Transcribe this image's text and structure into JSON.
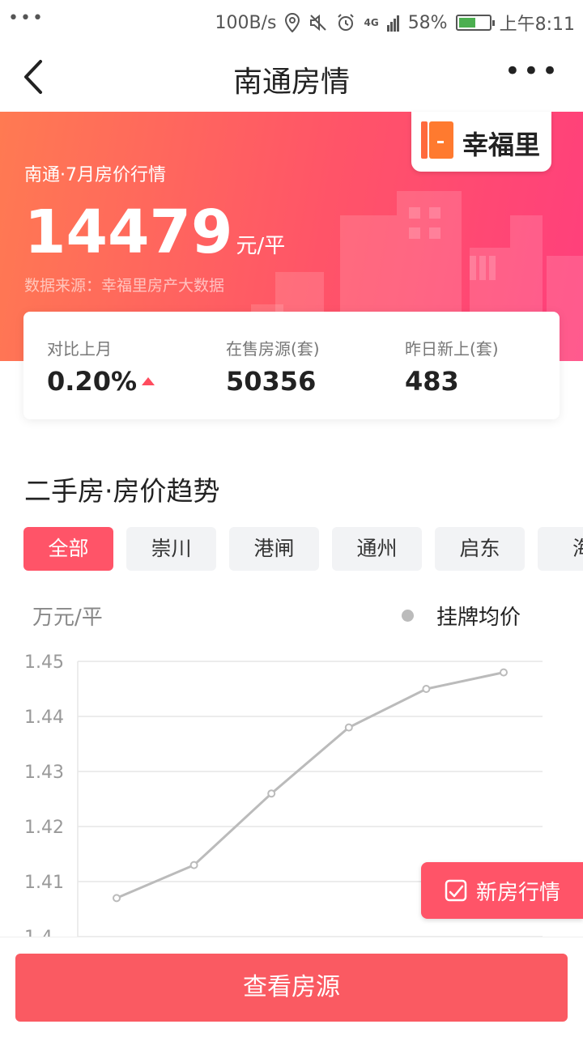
{
  "status_bar": {
    "dots": "•••",
    "speed": "100B/s",
    "network": "4G",
    "battery": "58%",
    "battery_level": 0.58,
    "time": "上午8:11"
  },
  "nav": {
    "title": "南通房情",
    "more": "•••"
  },
  "hero": {
    "subtitle": "南通·7月房价行情",
    "price": "14479",
    "unit": "元/平",
    "source": "数据来源：幸福里房产大数据",
    "logo_text": "幸福里"
  },
  "stats": [
    {
      "label": "对比上月",
      "value": "0.20%",
      "trend": "up"
    },
    {
      "label": "在售房源(套)",
      "value": "50356"
    },
    {
      "label": "昨日新上(套)",
      "value": "483"
    }
  ],
  "section": {
    "title": "二手房·房价趋势"
  },
  "tabs": [
    {
      "label": "全部",
      "active": true
    },
    {
      "label": "崇川"
    },
    {
      "label": "港闸"
    },
    {
      "label": "通州"
    },
    {
      "label": "启东"
    },
    {
      "label": "海"
    }
  ],
  "chart_data": {
    "type": "line",
    "ylabel": "万元/平",
    "series": [
      {
        "name": "挂牌均价",
        "values": [
          1.407,
          1.413,
          1.426,
          1.438,
          1.445,
          1.448
        ]
      }
    ],
    "yticks": [
      "1.45",
      "1.44",
      "1.43",
      "1.42",
      "1.41",
      "1.4"
    ],
    "ylim": [
      1.4,
      1.45
    ],
    "grid": true,
    "legend": "top-right",
    "color": "#bbbbbb"
  },
  "float_button": {
    "label": "新房行情"
  },
  "cta": {
    "label": "查看房源"
  },
  "colors": {
    "accent": "#ff5468",
    "cta": "#fa5a62"
  }
}
